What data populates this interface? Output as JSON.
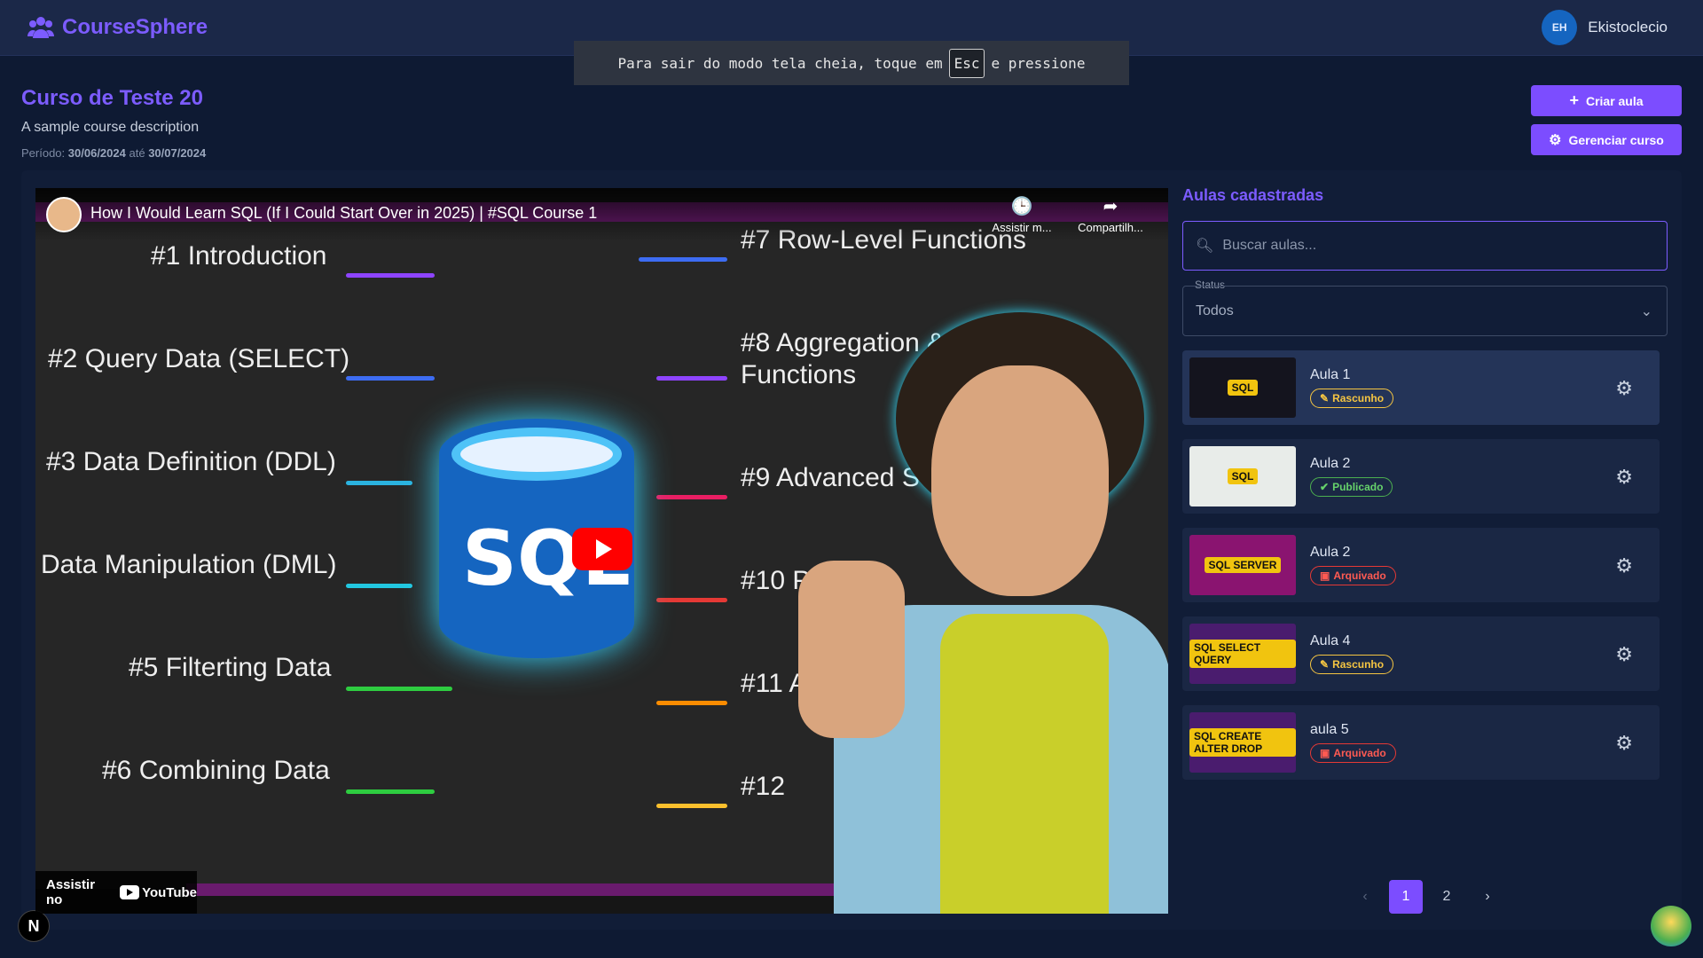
{
  "brand": {
    "name": "CourseSphere"
  },
  "user": {
    "initials": "EH",
    "name": "Ekistoclecio"
  },
  "fullscreen_toast": {
    "before": "Para sair do modo tela cheia, toque em",
    "key": "Esc",
    "after": "e pressione"
  },
  "course": {
    "title": "Curso de Teste 20",
    "description": "A sample course description",
    "period_label": "Período:",
    "start": "30/06/2024",
    "until": "até",
    "end": "30/07/2024"
  },
  "actions": {
    "create_lesson": "Criar aula",
    "manage_course": "Gerenciar curso"
  },
  "video": {
    "title": "How I Would Learn SQL (If I Could Start Over in 2025) | #SQL Course 1",
    "watch_later": "Assistir m...",
    "share": "Compartilh...",
    "watch_on": "Assistir no",
    "youtube": "YouTube",
    "thumbnail_text": "SQL",
    "topics": [
      "#1 Introduction",
      "#2 Query Data (SELECT)",
      "#3 Data Definition (DDL)",
      "Data Manipulation (DML)",
      "#5 Filterting Data",
      "#6 Combining Data",
      "#7 Row-Level Functions",
      "#8 Aggregation & Analytic",
      "Functions",
      "#9 Advanced SQL Te",
      "#10 Perform",
      "#11 Al",
      "#12"
    ]
  },
  "sidebar": {
    "title": "Aulas cadastradas",
    "search_placeholder": "Buscar aulas...",
    "status_label": "Status",
    "status_value": "Todos",
    "lessons": [
      {
        "name": "Aula 1",
        "status": "Rascunho",
        "thumb": "SQL"
      },
      {
        "name": "Aula 2",
        "status": "Publicado",
        "thumb": "SQL"
      },
      {
        "name": "Aula 2",
        "status": "Arquivado",
        "thumb": "SQL SERVER"
      },
      {
        "name": "Aula 4",
        "status": "Rascunho",
        "thumb": "SQL SELECT QUERY"
      },
      {
        "name": "aula 5",
        "status": "Arquivado",
        "thumb": "SQL CREATE ALTER DROP"
      }
    ]
  },
  "pagination": {
    "pages": [
      "1",
      "2"
    ],
    "current": "1",
    "prev": "‹",
    "next": "›"
  },
  "dev_badge": "N",
  "colors": {
    "accent": "#7c4dff",
    "background": "#0e1a33",
    "header": "#1b2848",
    "draft": "#f5c542",
    "published": "#4caf50",
    "archived": "#e53935"
  }
}
